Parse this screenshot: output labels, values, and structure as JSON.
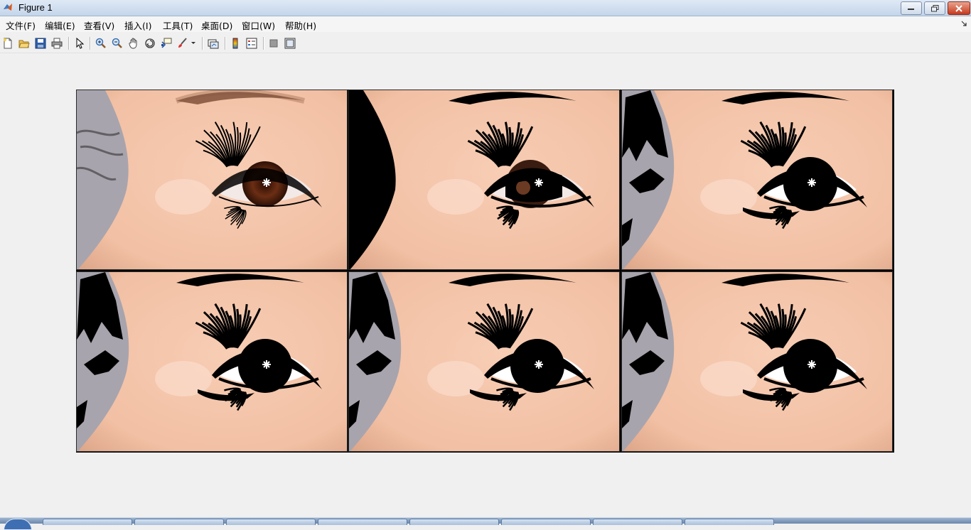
{
  "window": {
    "title": "Figure 1"
  },
  "menu": {
    "items": [
      "文件(F)",
      "编辑(E)",
      "查看(V)",
      "插入(I)",
      "工具(T)",
      "桌面(D)",
      "窗口(W)",
      "帮助(H)"
    ]
  },
  "toolbar": {
    "buttons": [
      "new-figure-icon",
      "open-file-icon",
      "save-icon",
      "print-icon",
      "pointer-arrow-icon",
      "zoom-in-icon",
      "zoom-out-icon",
      "pan-hand-icon",
      "rotate-3d-icon",
      "data-cursor-icon",
      "brush-icon",
      "link-plot-icon",
      "colorbar-icon",
      "legend-icon",
      "hide-plot-tools-icon",
      "show-plot-tools-icon"
    ]
  },
  "figure": {
    "panels": [
      {
        "id": "original",
        "mode": "original"
      },
      {
        "id": "seg-2",
        "mode": "segmented-light"
      },
      {
        "id": "seg-3",
        "mode": "segmented"
      },
      {
        "id": "seg-4",
        "mode": "segmented"
      },
      {
        "id": "seg-5",
        "mode": "segmented"
      },
      {
        "id": "seg-6",
        "mode": "segmented"
      }
    ]
  },
  "colors": {
    "skin": "#f2c0a4",
    "skin_shadow": "#d9a184",
    "background_grey": "#a8a4ad",
    "iris_brown": "#6b2e14",
    "dark_region": "#000000",
    "window_bg": "#f0f0f0",
    "titlebar": "#c4d5ea"
  }
}
